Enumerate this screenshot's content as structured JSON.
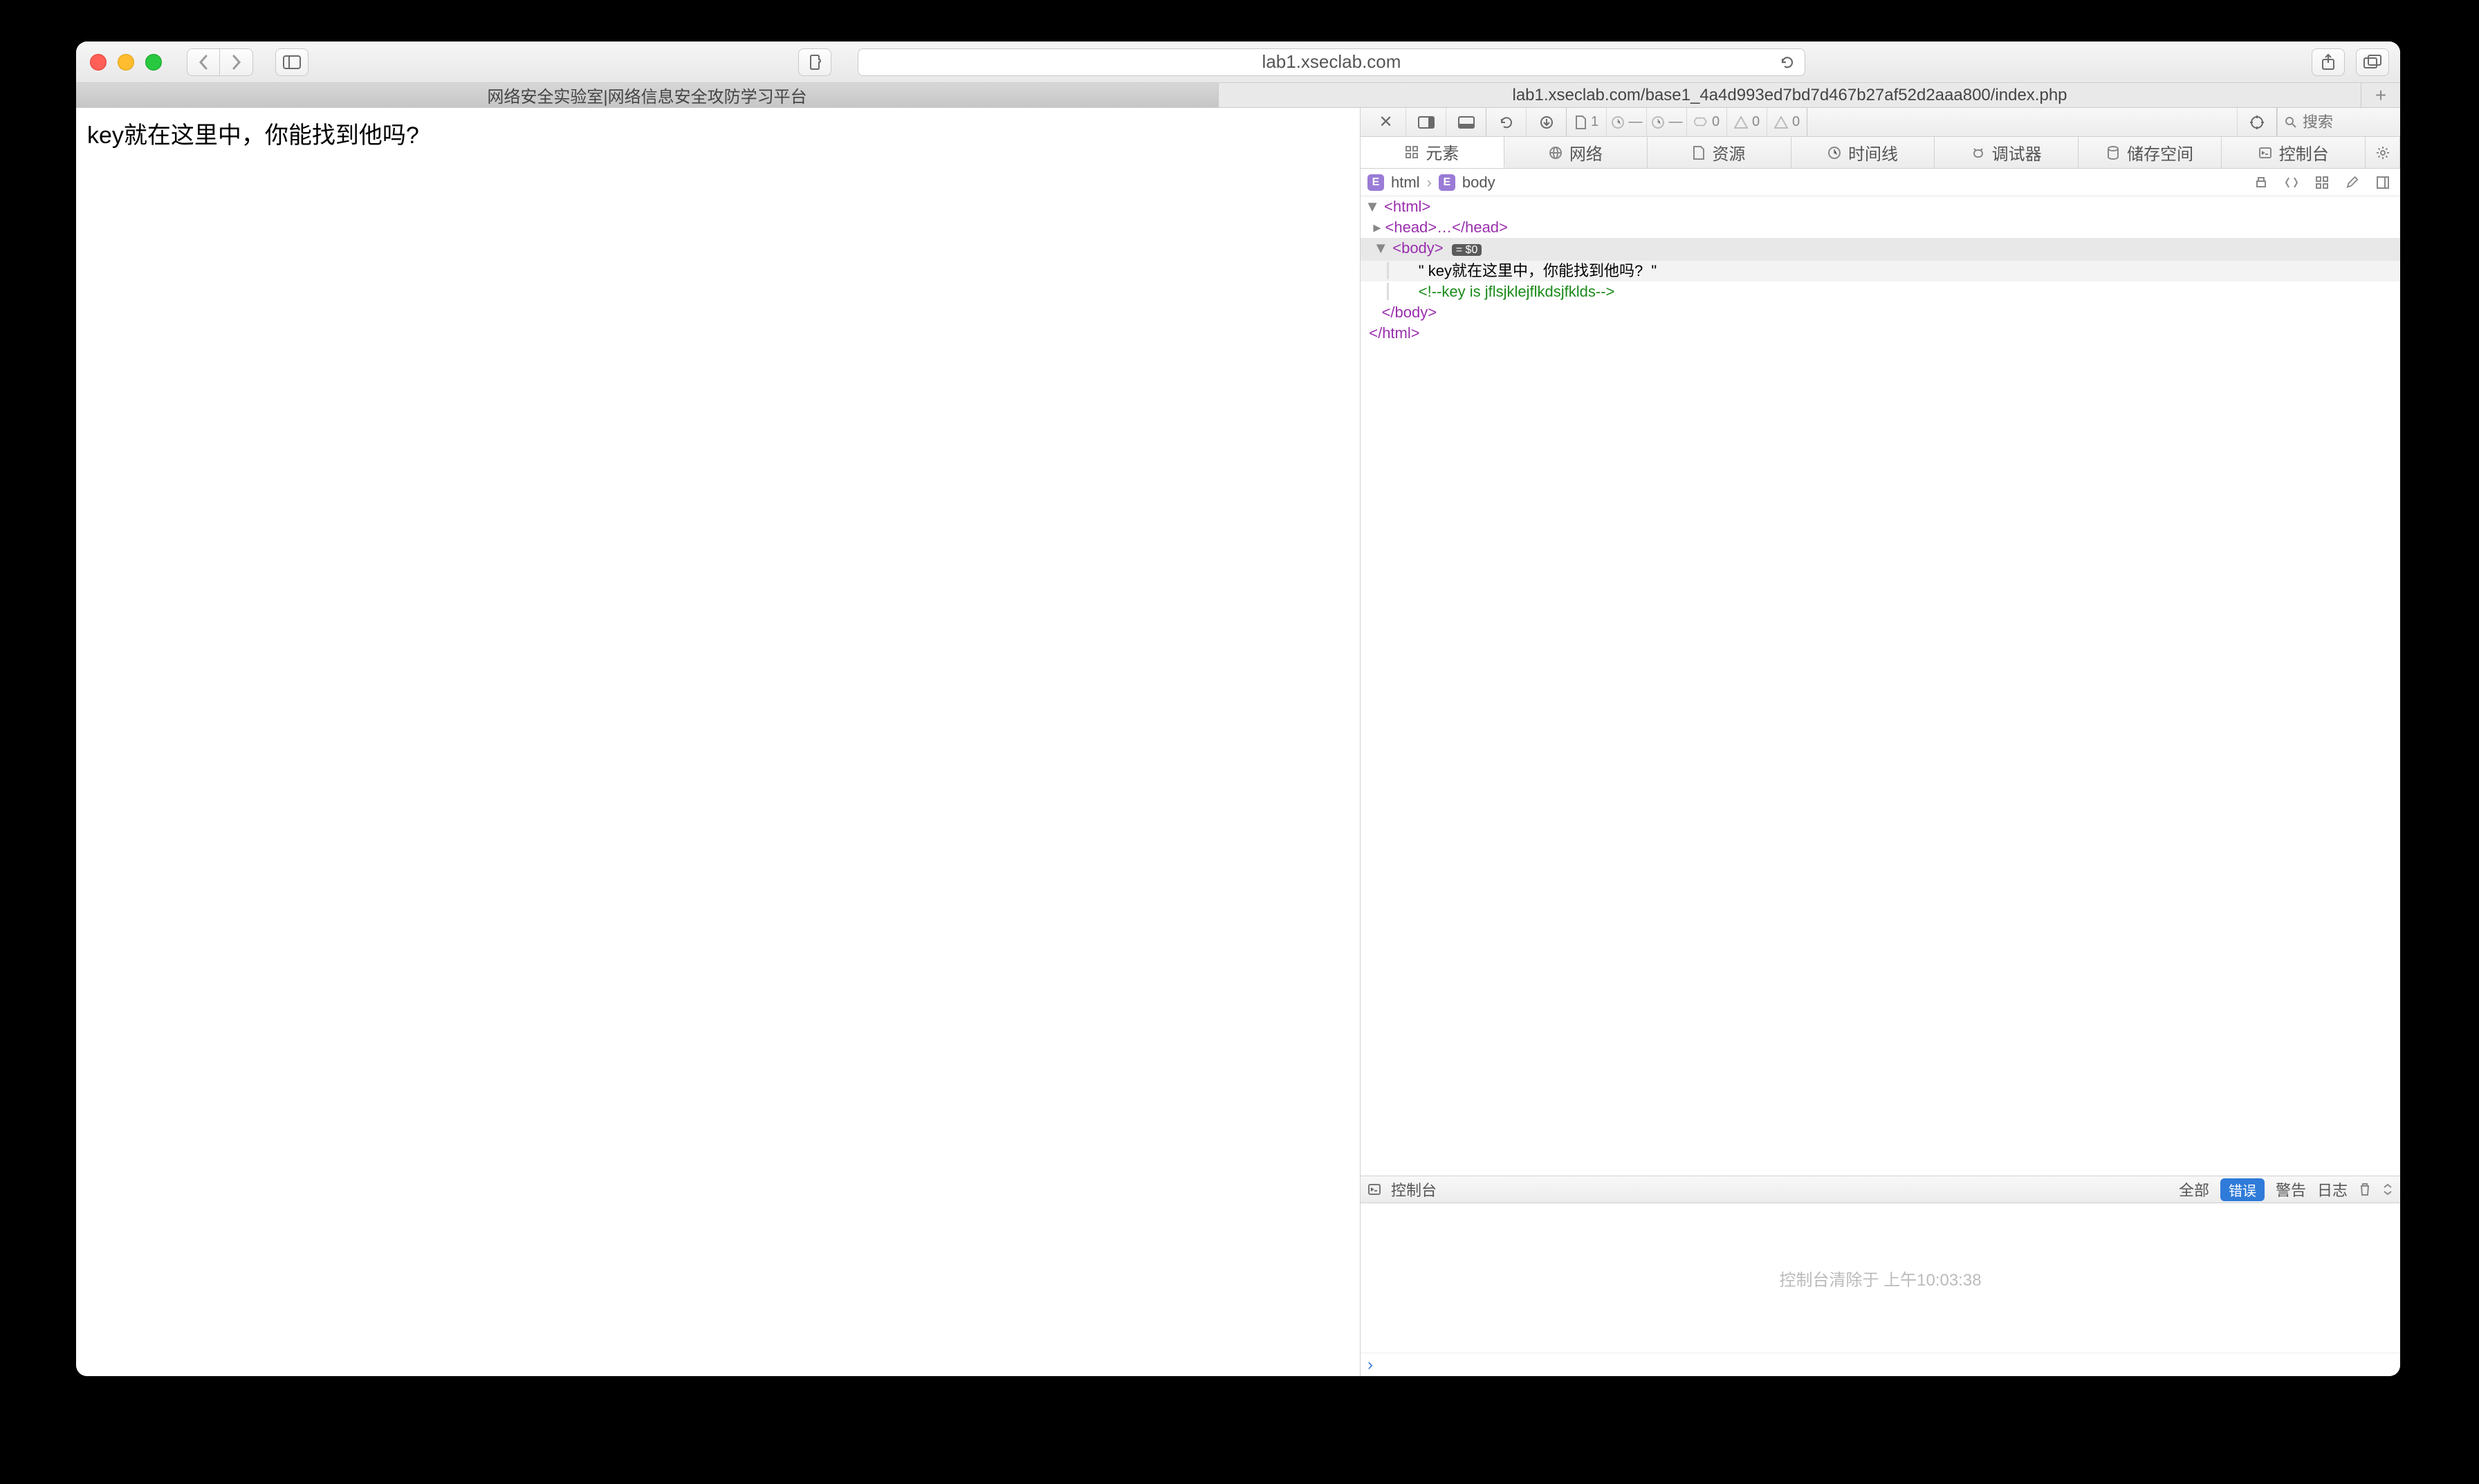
{
  "titlebar": {
    "url": "lab1.xseclab.com"
  },
  "tabs": [
    {
      "label": "网络安全实验室|网络信息安全攻防学习平台",
      "active": true
    },
    {
      "label": "lab1.xseclab.com/base1_4a4d993ed7bd7d467b27af52d2aaa800/index.php",
      "active": false
    }
  ],
  "page": {
    "text": "key就在这里中，你能找到他吗?"
  },
  "devToolbar": {
    "fileCount": "1",
    "timeCount": "—",
    "errCount": "0",
    "warnCount": "0",
    "logCount": "0",
    "searchPlaceholder": "搜索"
  },
  "devTabs": {
    "elements": "元素",
    "network": "网络",
    "resources": "资源",
    "timelines": "时间线",
    "debugger": "调试器",
    "storage": "储存空间",
    "console": "控制台"
  },
  "breadcrumb": {
    "root": "html",
    "child": "body"
  },
  "dom": {
    "htmlOpen": "<html>",
    "headSelf": "<head>…</head>",
    "bodyOpen": "<body>",
    "bodyBadge": "= $0",
    "textNode": "\" key就在这里中，你能找到他吗?  \"",
    "comment": "<!--key is jflsjklejflkdsjfklds-->",
    "bodyClose": "</body>",
    "htmlClose": "</html>"
  },
  "consoleHeader": {
    "title": "控制台",
    "all": "全部",
    "errors": "错误",
    "warnings": "警告",
    "logs": "日志"
  },
  "consoleMessage": "控制台清除于 上午10:03:38"
}
